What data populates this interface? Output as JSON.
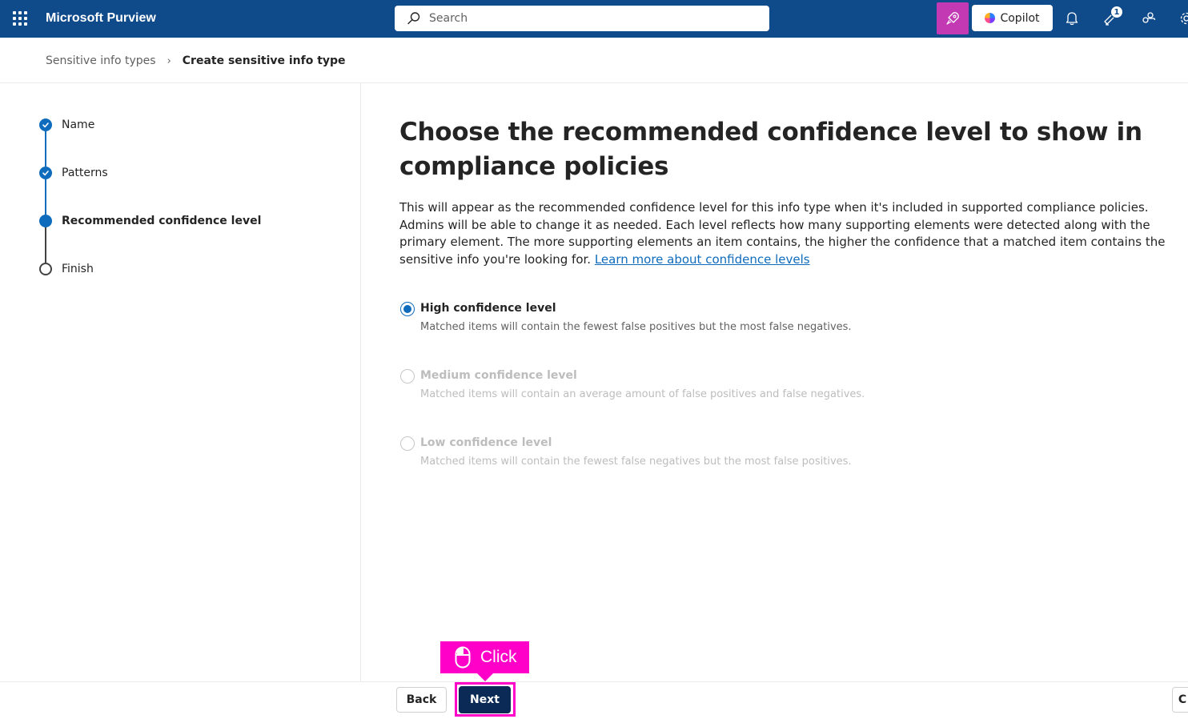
{
  "header": {
    "app_title": "Microsoft Purview",
    "search_placeholder": "Search",
    "copilot_label": "Copilot",
    "notification_badge": "1",
    "brand_color": "#0f4a8a",
    "accent_color": "#c239b3"
  },
  "breadcrumb": {
    "parent": "Sensitive info types",
    "current": "Create sensitive info type"
  },
  "steps": [
    {
      "label": "Name",
      "state": "completed"
    },
    {
      "label": "Patterns",
      "state": "completed"
    },
    {
      "label": "Recommended confidence level",
      "state": "current"
    },
    {
      "label": "Finish",
      "state": "not-started"
    }
  ],
  "main": {
    "title": "Choose the recommended confidence level to show in compliance policies",
    "description": "This will appear as the recommended confidence level for this info type when it's included in supported compliance policies. Admins will be able to change it as needed. Each level reflects how many supporting elements were detected along with the primary element. The more supporting elements an item contains, the higher the confidence that a matched item contains the sensitive info you're looking for. ",
    "learn_more_link": "Learn more about confidence levels",
    "options": [
      {
        "label": "High confidence level",
        "description": "Matched items will contain the fewest false positives but the most false negatives.",
        "selected": true,
        "enabled": true
      },
      {
        "label": "Medium confidence level",
        "description": "Matched items will contain an average amount of false positives and false negatives.",
        "selected": false,
        "enabled": false
      },
      {
        "label": "Low confidence level",
        "description": "Matched items will contain the fewest false negatives but the most false positives.",
        "selected": false,
        "enabled": false
      }
    ]
  },
  "footer": {
    "back_label": "Back",
    "next_label": "Next",
    "cancel_label": "C"
  },
  "annotation": {
    "callout_text": "Click",
    "highlight_color": "#ff00c8"
  },
  "icons": [
    "app-launcher-icon",
    "search-icon",
    "rocket-icon",
    "copilot-icon",
    "bell-icon",
    "megaphone-icon",
    "people-icon",
    "gear-icon",
    "chevron-right-icon",
    "checkmark-icon",
    "mouse-icon"
  ]
}
